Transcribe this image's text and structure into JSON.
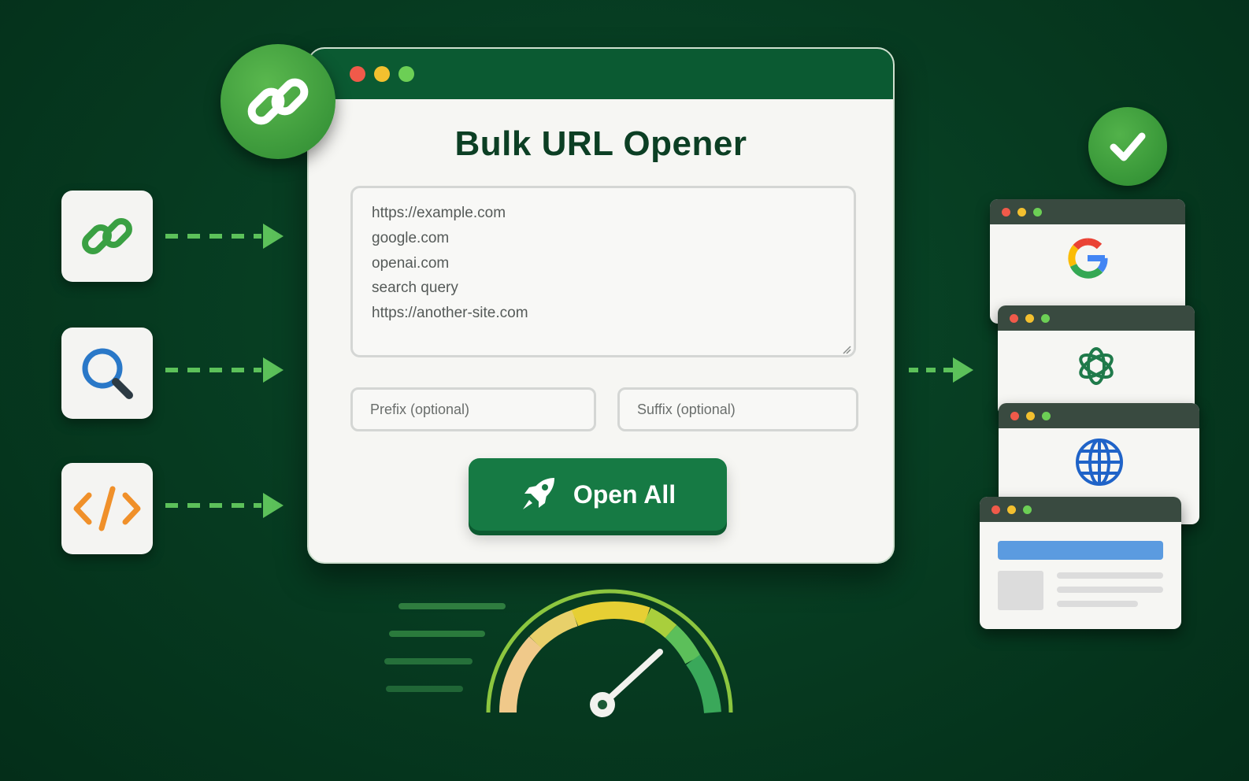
{
  "app": {
    "title": "Bulk URL Opener",
    "urls_text": "https://example.com\ngoogle.com\nopenai.com\nsearch query\nhttps://another-site.com",
    "prefix_placeholder": "Prefix (optional)",
    "suffix_placeholder": "Suffix (optional)",
    "open_button_label": "Open All"
  },
  "inputs": [
    {
      "icon": "link-icon"
    },
    {
      "icon": "search-icon"
    },
    {
      "icon": "code-icon"
    }
  ],
  "outputs": [
    {
      "icon": "google-logo-icon"
    },
    {
      "icon": "openai-logo-icon"
    },
    {
      "icon": "globe-icon"
    },
    {
      "icon": "webpage-layout-icon"
    }
  ],
  "colors": {
    "background": "#063a20",
    "window_bar": "#0b5a32",
    "button": "#167a44",
    "accent_green": "#4cae4c",
    "title_text": "#0c3f24"
  }
}
